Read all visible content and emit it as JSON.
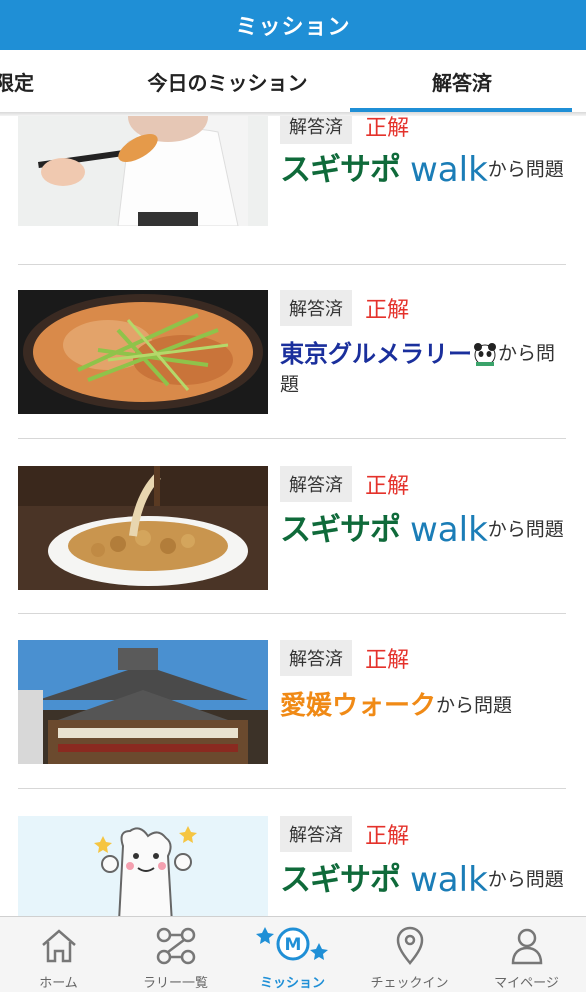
{
  "header": {
    "title": "ミッション"
  },
  "tabs": [
    {
      "label": "限定"
    },
    {
      "label": "今日のミッション"
    },
    {
      "label": "解答済"
    }
  ],
  "items": [
    {
      "badge": "解答済",
      "result": "正解",
      "source_logo": "スギサポ",
      "source_logo_sub": "walk",
      "source_tail": "から問題"
    },
    {
      "badge": "解答済",
      "result": "正解",
      "source_logo": "東京グルメラリー",
      "source_tail": "から問題"
    },
    {
      "badge": "解答済",
      "result": "正解",
      "source_logo": "スギサポ",
      "source_logo_sub": "walk",
      "source_tail": "から問題"
    },
    {
      "badge": "解答済",
      "result": "正解",
      "source_logo": "愛媛ウォーク",
      "source_tail": "から問題"
    },
    {
      "badge": "解答済",
      "result": "正解",
      "source_logo": "スギサポ",
      "source_logo_sub": "walk",
      "source_tail": "から問題"
    }
  ],
  "bottom_nav": [
    {
      "label": "ホーム",
      "icon": "home-icon"
    },
    {
      "label": "ラリー一覧",
      "icon": "rally-icon"
    },
    {
      "label": "ミッション",
      "icon": "mission-icon"
    },
    {
      "label": "チェックイン",
      "icon": "checkin-icon"
    },
    {
      "label": "マイページ",
      "icon": "user-icon"
    }
  ],
  "colors": {
    "primary": "#1f8fd6",
    "correct": "#e4322b",
    "suginosapo": "#0f6a3a",
    "walk": "#1b7db7",
    "tokyo": "#1a2f9c",
    "ehime": "#f08a16"
  }
}
